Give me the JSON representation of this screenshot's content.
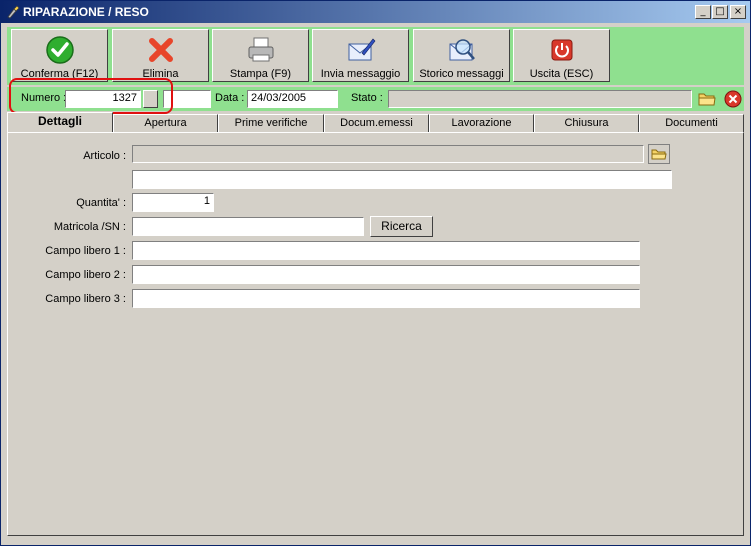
{
  "window": {
    "title": "RIPARAZIONE / RESO"
  },
  "titlebar_buttons": {
    "minimize": "_",
    "maximize": "□",
    "close": "×"
  },
  "toolbar": {
    "buttons": [
      {
        "label": "Conferma (F12)"
      },
      {
        "label": "Elimina"
      },
      {
        "label": "Stampa (F9)"
      },
      {
        "label": "Invia messaggio"
      },
      {
        "label": "Storico messaggi"
      },
      {
        "label": "Uscita (ESC)"
      }
    ]
  },
  "header": {
    "numero_label": "Numero :",
    "numero_value": "1327",
    "suffix_value": "",
    "data_label": "Data :",
    "data_value": "24/03/2005",
    "stato_label": "Stato :",
    "stato_value": ""
  },
  "tabs": [
    {
      "label": "Dettagli"
    },
    {
      "label": "Apertura"
    },
    {
      "label": "Prime verifiche"
    },
    {
      "label": "Docum.emessi"
    },
    {
      "label": "Lavorazione"
    },
    {
      "label": "Chiusura"
    },
    {
      "label": "Documenti"
    }
  ],
  "form": {
    "articolo_label": "Articolo :",
    "articolo_value": "",
    "descrizione_value": "",
    "quantita_label": "Quantita' :",
    "quantita_value": "1",
    "matricola_label": "Matricola /SN :",
    "matricola_value": "",
    "ricerca_label": "Ricerca",
    "campo1_label": "Campo libero 1 :",
    "campo1_value": "",
    "campo2_label": "Campo libero 2 :",
    "campo2_value": "",
    "campo3_label": "Campo libero 3 :",
    "campo3_value": ""
  },
  "colors": {
    "accent_green": "#8fe08f",
    "highlight_red": "#e01010",
    "title_blue": "#0a246a"
  }
}
